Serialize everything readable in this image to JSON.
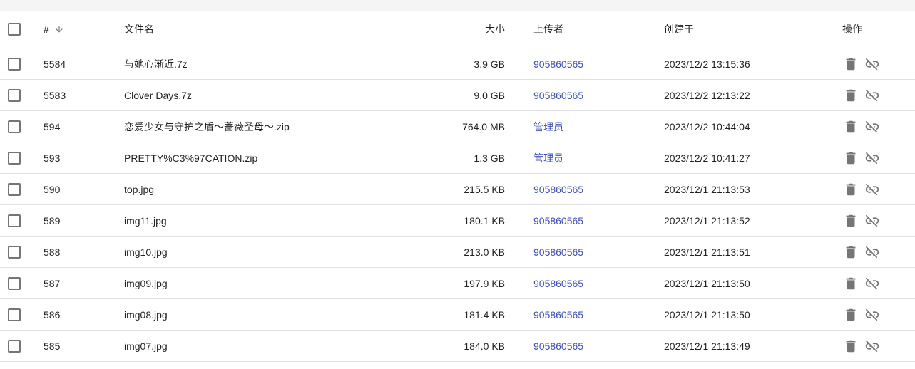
{
  "table": {
    "headers": {
      "id": "#",
      "name": "文件名",
      "size": "大小",
      "uploader": "上传者",
      "created": "创建于",
      "actions": "操作"
    },
    "rows": [
      {
        "id": "5584",
        "name": "与她心渐近.7z",
        "size": "3.9 GB",
        "uploader": "905860565",
        "created": "2023/12/2 13:15:36"
      },
      {
        "id": "5583",
        "name": "Clover Days.7z",
        "size": "9.0 GB",
        "uploader": "905860565",
        "created": "2023/12/2 12:13:22"
      },
      {
        "id": "594",
        "name": "恋爱少女与守护之盾～蔷薇圣母～.zip",
        "size": "764.0 MB",
        "uploader": "管理员",
        "created": "2023/12/2 10:44:04"
      },
      {
        "id": "593",
        "name": "PRETTY%C3%97CATION.zip",
        "size": "1.3 GB",
        "uploader": "管理员",
        "created": "2023/12/2 10:41:27"
      },
      {
        "id": "590",
        "name": "top.jpg",
        "size": "215.5 KB",
        "uploader": "905860565",
        "created": "2023/12/1 21:13:53"
      },
      {
        "id": "589",
        "name": "img11.jpg",
        "size": "180.1 KB",
        "uploader": "905860565",
        "created": "2023/12/1 21:13:52"
      },
      {
        "id": "588",
        "name": "img10.jpg",
        "size": "213.0 KB",
        "uploader": "905860565",
        "created": "2023/12/1 21:13:51"
      },
      {
        "id": "587",
        "name": "img09.jpg",
        "size": "197.9 KB",
        "uploader": "905860565",
        "created": "2023/12/1 21:13:50"
      },
      {
        "id": "586",
        "name": "img08.jpg",
        "size": "181.4 KB",
        "uploader": "905860565",
        "created": "2023/12/1 21:13:50"
      },
      {
        "id": "585",
        "name": "img07.jpg",
        "size": "184.0 KB",
        "uploader": "905860565",
        "created": "2023/12/1 21:13:49"
      }
    ]
  },
  "icons": {
    "sort": "arrow-down-icon",
    "delete": "delete-icon",
    "unlink": "link-off-icon"
  },
  "colors": {
    "link": "#3f51b5",
    "icon": "#757575",
    "divider": "#e0e0e0"
  }
}
